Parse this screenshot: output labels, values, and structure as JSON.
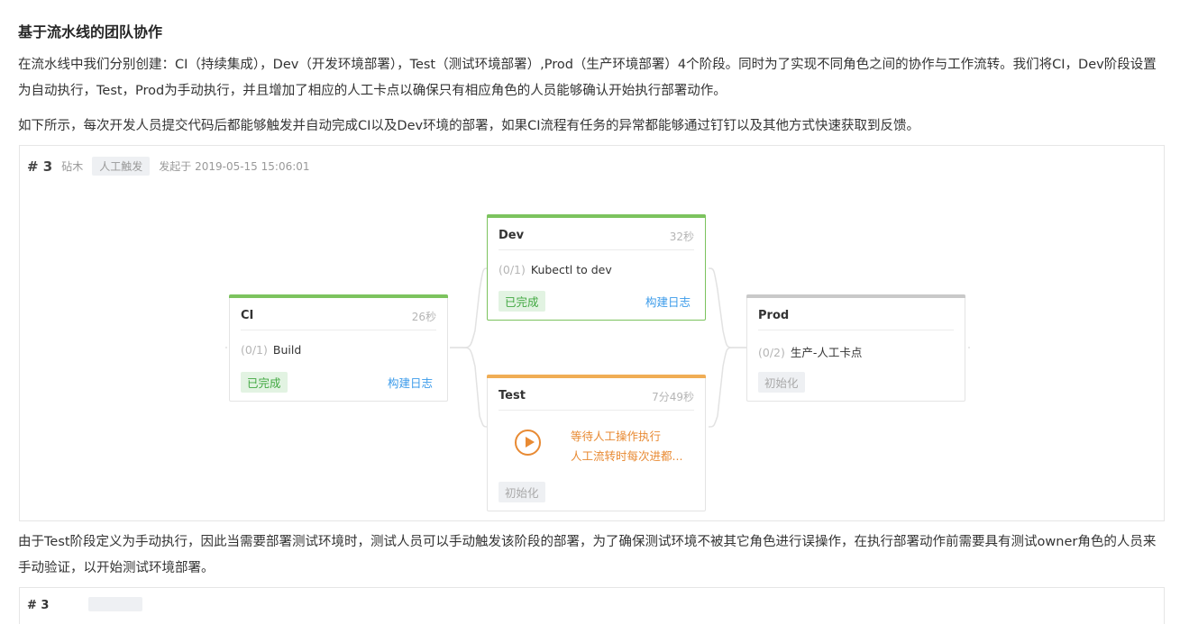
{
  "article": {
    "heading": "基于流水线的团队协作",
    "p1": "在流水线中我们分别创建：CI（持续集成），Dev（开发环境部署），Test（测试环境部署）,Prod（生产环境部署）4个阶段。同时为了实现不同角色之间的协作与工作流转。我们将CI，Dev阶段设置为自动执行，Test，Prod为手动执行，并且增加了相应的人工卡点以确保只有相应角色的人员能够确认开始执行部署动作。",
    "p2": "如下所示，每次开发人员提交代码后都能够触发并自动完成CI以及Dev环境的部署，如果CI流程有任务的异常都能够通过钉钉以及其他方式快速获取到反馈。",
    "p3": "由于Test阶段定义为手动执行，因此当需要部署测试环境时，测试人员可以手动触发该阶段的部署，为了确保测试环境不被其它角色进行误操作，在执行部署动作前需要具有测试owner角色的人员来手动验证，以开始测试环境部署。"
  },
  "pipeline": {
    "run_number": "# 3",
    "author": "砧木",
    "trigger": "人工触发",
    "started": "发起于 2019-05-15 15:06:01",
    "colors": {
      "success": "#7cc35e",
      "pending": "#f0ad55",
      "idle": "#c9c9c9",
      "link": "#3b9bea"
    },
    "stages": {
      "ci": {
        "name": "CI",
        "duration": "26秒",
        "task_count": "(0/1)",
        "task": "Build",
        "status": "已完成",
        "log": "构建日志"
      },
      "dev": {
        "name": "Dev",
        "duration": "32秒",
        "task_count": "(0/1)",
        "task": "Kubectl to dev",
        "status": "已完成",
        "log": "构建日志"
      },
      "test": {
        "name": "Test",
        "duration": "7分49秒",
        "wait_line1": "等待人工操作执行",
        "wait_line2": "人工流转时每次进都...",
        "status": "初始化"
      },
      "prod": {
        "name": "Prod",
        "duration": "",
        "task_count": "(0/2)",
        "task": "生产-人工卡点",
        "status": "初始化"
      }
    }
  },
  "next_pipeline": {
    "run_number": "# 3"
  }
}
